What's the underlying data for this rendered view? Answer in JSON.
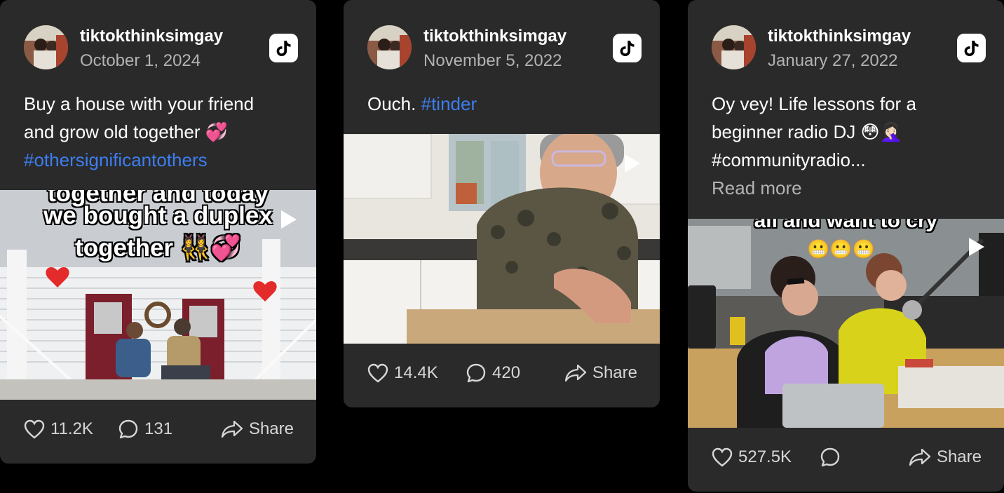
{
  "cards": [
    {
      "username": "tiktokthinksimgay",
      "date": "October 1, 2024",
      "caption": "Buy a house with your friend and grow old together 💞",
      "hashtag": "#othersignificantothers",
      "overlay": [
        "together and today",
        "we bought a duplex",
        "together 👯‍♀️💞"
      ],
      "likes": "11.2K",
      "comments": "131",
      "share_label": "Share"
    },
    {
      "username": "tiktokthinksimgay",
      "date": "November 5, 2022",
      "caption": "Ouch.",
      "hashtag": "#tinder",
      "likes": "14.4K",
      "comments": "420",
      "share_label": "Share"
    },
    {
      "username": "tiktokthinksimgay",
      "date": "January 27, 2022",
      "caption": "Oy vey! Life lessons for a beginner radio DJ 😳🤦🏻‍♀️",
      "hashtag": "#communityradio...",
      "read_more": "Read more",
      "overlay": [
        "all and want to cry",
        "😬😬😬"
      ],
      "likes": "527.5K",
      "comments": "",
      "share_label": "Share"
    }
  ],
  "colors": {
    "card_bg": "#2a2a2a",
    "hashtag": "#3d7ef0",
    "secondary_text": "#b3b3b3"
  },
  "icons": [
    "tiktok-icon",
    "play-icon",
    "heart-icon",
    "comment-icon",
    "share-icon"
  ]
}
